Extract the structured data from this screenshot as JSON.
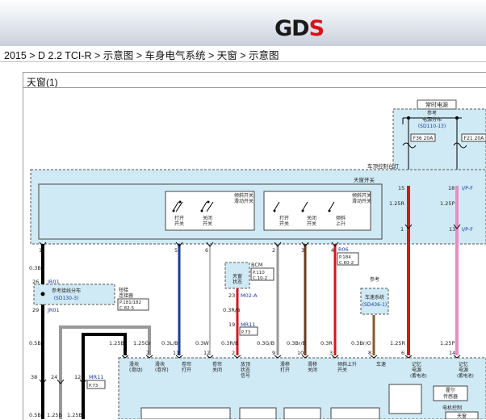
{
  "header": {
    "logo_text_main": "GD",
    "logo_text_accent": "S",
    "logo_accent_color": "#d8121b"
  },
  "breadcrumb": {
    "text": "2015 > D 2.2 TCI-R > 示意图 > 车身电气系统 > 天窗 > 示意图"
  },
  "diagram": {
    "title": "天窗(1)",
    "labels": {
      "always_power": "常时电源",
      "ref_dist_1": "参考",
      "ref_dist_2": "电源分布",
      "ref_dist_3": "(SD110-13)",
      "fuse1": "F36 20A",
      "fuse2": "F21 20A",
      "roof_module": "车顶控制台灯",
      "sunroof_sw": "天窗开关",
      "tilt_sw": "倾斜开关",
      "slide_sw": "滑动开关",
      "open_1": "打开",
      "open_1b": "开关",
      "close_1": "关闭",
      "close_1b": "开关",
      "open_2": "打开",
      "open_2b": "开关",
      "close_2": "关闭",
      "close_2b": "开关",
      "tilt_up": "倾斜",
      "tilt_up_b": "上升",
      "joint_label_1": "短接",
      "joint_label_2": "连接器",
      "joint_ref_1": "参考接线分布",
      "joint_ref_2": "(SD130-3)",
      "joint_page_1": "P.181/182",
      "joint_page_2": "C.82-5",
      "bcm": "BCM",
      "bcm_p1": "P.110",
      "bcm_p2": "C.10-2",
      "sunroof_state": "天窗",
      "sunroof_state_b": "状态",
      "m02": "M02-A",
      "mr11_a": "MR11",
      "mr11_a_p": "P.73",
      "r06": "R06",
      "r06_p1": "P.184",
      "r06_p2": "C.60-2",
      "speed_ref_1": "参考",
      "speed_ref_2": "车速系统",
      "speed_ref_3": "(SD436-1)",
      "jr01_a": "JR01",
      "jr01_b": "JR01",
      "mr11_b": "MR11",
      "mr11_b_p": "P.73",
      "d_slide_1": "滑块",
      "d_slide_1b": "(滑动)",
      "d_slide_2": "滑块",
      "d_slide_2b": "(卷帘)",
      "d_roll_open": "卷帘",
      "d_roll_open_b": "打开",
      "d_roll_close": "卷帘",
      "d_roll_close_b": "关闭",
      "d_state": "放顶",
      "d_state_b": "状态",
      "d_state_c": "信号",
      "d_slide_open": "滑移",
      "d_slide_open_b": "打开",
      "d_slide_close": "滑移",
      "d_slide_close_b": "关闭",
      "d_tilt": "倾斜上升",
      "d_tilt_b": "开关",
      "d_speed": "车速",
      "d_mem_1": "记忆",
      "d_mem_1b": "电源",
      "d_mem_1c": "(蓄电池)",
      "d_mem_2": "记忆",
      "d_mem_2b": "电源",
      "d_mem_2c": "(蓄电池)",
      "rain_sensor_1": "霍尔",
      "rain_sensor_2": "传感器",
      "motor_ctrl": "电机控制",
      "motor_ctrl_b": "天窗"
    },
    "wires": {
      "w1": "0.3B",
      "w2": "0.5B",
      "w3": "0.5B",
      "w4": "1.25B",
      "w5": "1.25B",
      "w6": "1.25B",
      "w7": "1.25Gr",
      "w8": "0.3L/B",
      "w9": "0.3W",
      "w10": "0.3R/B",
      "w11": "0.3R/B",
      "w12": "0.3G/B",
      "w13": "0.3Br/B",
      "w14": "0.3R",
      "w15": "0.3Br/O",
      "w16": "1.25R",
      "w17": "1.25R",
      "w18": "1.25P",
      "w19": "1.25P"
    },
    "pins": {
      "p1": "1",
      "p5": "5",
      "p6": "6",
      "p2": "2",
      "p3": "3",
      "p4": "4",
      "p15": "15",
      "p18": "18",
      "p1b": "1",
      "p13": "13",
      "p26": "26",
      "p29": "29",
      "p23": "23",
      "p19": "19",
      "p38": "38",
      "p24": "24",
      "p12": "12",
      "pp1": "1",
      "pp7": "7",
      "pp11": "11",
      "pp12": "12",
      "pp2": "2",
      "pp9": "9",
      "pp10": "10",
      "pp3": "3",
      "pp8": "8",
      "pp6": "6",
      "pp14": "14",
      "fuse_ip_f": "I/P-F",
      "fuse_ip_f2": "I/P-F"
    },
    "colors": {
      "blue": "#1a3c9e",
      "red": "#d51818",
      "brown": "#6b3a1f",
      "pink": "#e88cc2",
      "gray": "#999999",
      "black": "#000000"
    }
  }
}
